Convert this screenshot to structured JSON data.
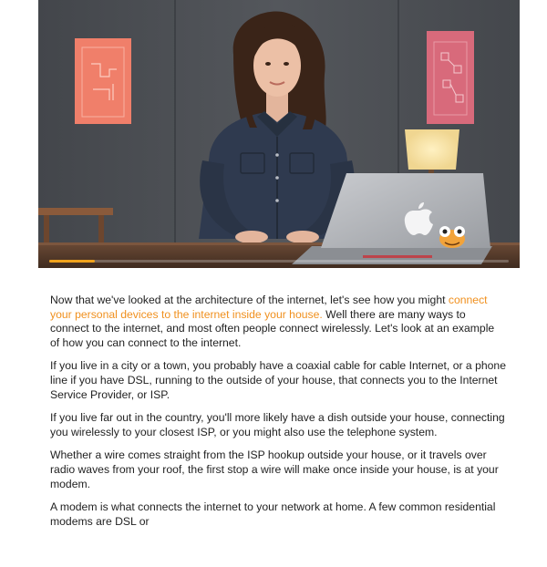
{
  "video": {
    "progress_fraction": 0.1,
    "accent_color": "#f0a21c",
    "laptop_logo": "apple-logo-icon",
    "laptop_sticker": "frog-sticker-icon"
  },
  "transcript": {
    "link_color": "#f0901e",
    "p1_before": "Now that we've looked at the architecture of the internet, let's see how you might ",
    "p1_link": "connect your personal devices to the internet inside your house.",
    "p1_after": " Well there are many ways to connect to the internet, and most often people connect wirelessly. Let's look at an example of how you can connect to the internet.",
    "p2": "If you live in a city or a town, you probably have a coaxial cable for cable Internet, or a phone line if you have DSL, running to the outside of your house, that connects you to the Internet Service Provider, or ISP.",
    "p3": "If you live far out in the country, you'll more likely have a dish outside your house, connecting you wirelessly to your closest ISP, or you might also use the telephone system.",
    "p4": "Whether a wire comes straight from the ISP hookup outside your house, or it travels over radio waves from your roof, the first stop a wire will make once inside your house, is at your modem.",
    "p5": "A modem is what connects the internet to your network at home. A few common residential modems are DSL or"
  }
}
